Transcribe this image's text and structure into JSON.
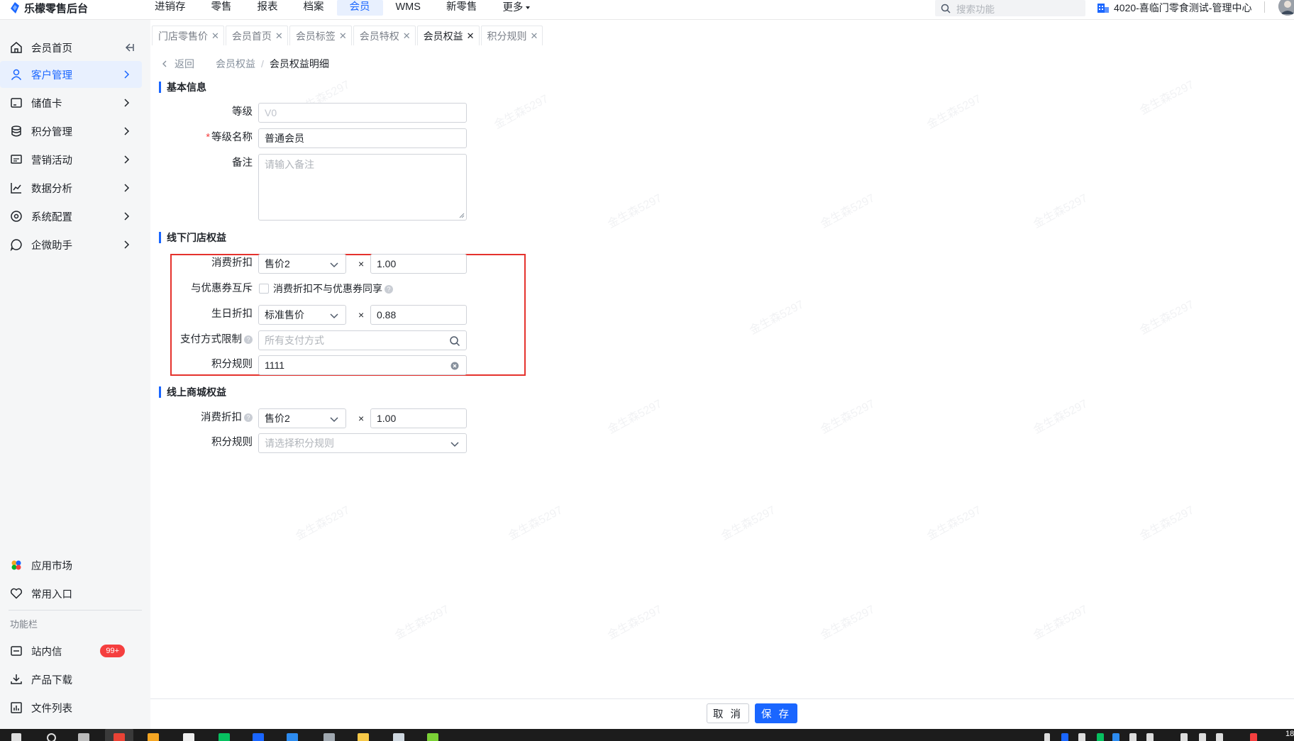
{
  "app": {
    "brand": "乐檬零售后台"
  },
  "topnav": {
    "items": [
      "进销存",
      "零售",
      "报表",
      "档案",
      "会员",
      "WMS",
      "新零售",
      "更多"
    ],
    "active": "会员"
  },
  "search": {
    "placeholder": "搜索功能"
  },
  "org": {
    "name": "4020-喜临门零食测试-管理中心"
  },
  "sidebar": {
    "items": [
      {
        "label": "会员首页",
        "icon": "home-icon"
      },
      {
        "label": "客户管理",
        "icon": "user-icon",
        "active": true
      },
      {
        "label": "储值卡",
        "icon": "card-icon"
      },
      {
        "label": "积分管理",
        "icon": "database-icon"
      },
      {
        "label": "营销活动",
        "icon": "marketing-icon"
      },
      {
        "label": "数据分析",
        "icon": "chart-icon"
      },
      {
        "label": "系统配置",
        "icon": "settings-icon"
      },
      {
        "label": "企微助手",
        "icon": "chat-icon"
      }
    ],
    "bottom": [
      {
        "label": "应用市场",
        "icon": "app-market-icon"
      },
      {
        "label": "常用入口",
        "icon": "heart-icon"
      }
    ],
    "section_label": "功能栏",
    "tools": [
      {
        "label": "站内信",
        "icon": "mail-icon",
        "badge": "99+"
      },
      {
        "label": "产品下载",
        "icon": "download-icon"
      },
      {
        "label": "文件列表",
        "icon": "file-list-icon"
      }
    ]
  },
  "tabs": [
    {
      "label": "门店零售价"
    },
    {
      "label": "会员首页"
    },
    {
      "label": "会员标签"
    },
    {
      "label": "会员特权"
    },
    {
      "label": "会员权益",
      "active": true
    },
    {
      "label": "积分规则"
    }
  ],
  "breadcrumb": {
    "back": "返回",
    "parent": "会员权益",
    "current": "会员权益明细"
  },
  "basic": {
    "title": "基本信息",
    "level_label": "等级",
    "level_value": "V0",
    "name_label": "等级名称",
    "name_value": "普通会员",
    "remark_label": "备注",
    "remark_placeholder": "请输入备注"
  },
  "offline": {
    "title": "线下门店权益",
    "discount_label": "消费折扣",
    "discount_select": "售价2",
    "discount_value": "1.00",
    "coupon_label": "与优惠券互斥",
    "coupon_checkbox_label": "消费折扣不与优惠券同享",
    "birthday_label": "生日折扣",
    "birthday_select": "标准售价",
    "birthday_value": "0.88",
    "payment_label": "支付方式限制",
    "payment_placeholder": "所有支付方式",
    "points_label": "积分规则",
    "points_value": "1111"
  },
  "online": {
    "title": "线上商城权益",
    "discount_label": "消费折扣",
    "discount_select": "售价2",
    "discount_value": "1.00",
    "points_label": "积分规则",
    "points_placeholder": "请选择积分规则"
  },
  "multiply_symbol": "×",
  "help_symbol": "?",
  "footer": {
    "cancel": "取 消",
    "save": "保 存"
  },
  "watermark": "金生森5297",
  "taskbar": {
    "time": "18"
  },
  "colors": {
    "primary": "#1a66ff",
    "highlight": "#e5322d",
    "badge": "#f53f3f"
  }
}
